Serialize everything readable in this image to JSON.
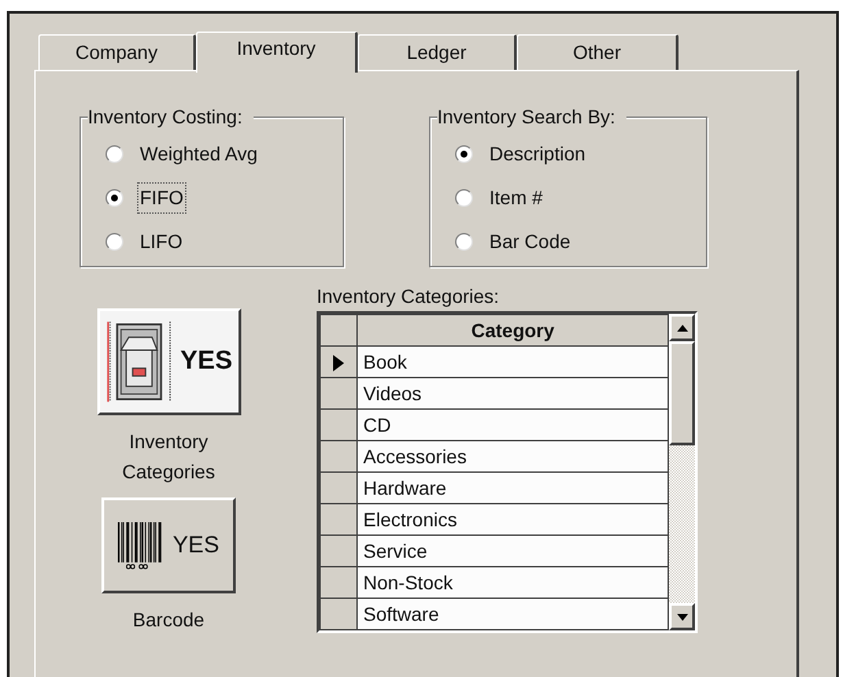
{
  "tabs": [
    {
      "label": "Company",
      "selected": false
    },
    {
      "label": "Inventory",
      "selected": true
    },
    {
      "label": "Ledger",
      "selected": false
    },
    {
      "label": "Other",
      "selected": false
    }
  ],
  "groups": [
    {
      "title": "Inventory Costing:",
      "options": [
        {
          "label": "Weighted Avg",
          "selected": false,
          "focused": false
        },
        {
          "label": "FIFO",
          "selected": true,
          "focused": true
        },
        {
          "label": "LIFO",
          "selected": false,
          "focused": false
        }
      ]
    },
    {
      "title": "Inventory Search By:",
      "options": [
        {
          "label": "Description",
          "selected": true,
          "focused": false
        },
        {
          "label": "Item #",
          "selected": false,
          "focused": false
        },
        {
          "label": "Bar Code",
          "selected": false,
          "focused": false
        }
      ]
    }
  ],
  "toggles": [
    {
      "kind": "switch",
      "value": "YES",
      "caption": "Inventory Categories"
    },
    {
      "kind": "barcode",
      "value": "YES",
      "caption": "Barcode"
    }
  ],
  "categories": {
    "label": "Inventory Categories:",
    "column": "Category",
    "rows": [
      {
        "name": "Book",
        "selected": true
      },
      {
        "name": "Videos",
        "selected": false
      },
      {
        "name": "CD",
        "selected": false
      },
      {
        "name": "Accessories",
        "selected": false
      },
      {
        "name": "Hardware",
        "selected": false
      },
      {
        "name": "Electronics",
        "selected": false
      },
      {
        "name": "Service",
        "selected": false
      },
      {
        "name": "Non-Stock",
        "selected": false
      },
      {
        "name": "Software",
        "selected": false
      }
    ]
  }
}
